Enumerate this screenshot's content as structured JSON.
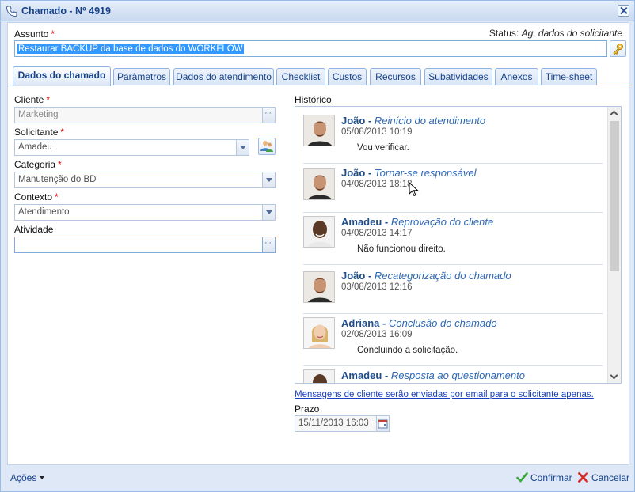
{
  "window": {
    "title": "Chamado - Nº 4919"
  },
  "header": {
    "subject_label": "Assunto",
    "status_prefix": "Status:",
    "status_value": "Ag. dados do solicitante",
    "subject_value": "Restaurar BACKUP da base de dados do WORKFLOW"
  },
  "tabs": [
    {
      "label": "Dados do chamado"
    },
    {
      "label": "Parâmetros"
    },
    {
      "label": "Dados do atendimento"
    },
    {
      "label": "Checklist"
    },
    {
      "label": "Custos"
    },
    {
      "label": "Recursos"
    },
    {
      "label": "Subatividades"
    },
    {
      "label": "Anexos"
    },
    {
      "label": "Time-sheet"
    }
  ],
  "form": {
    "cliente_label": "Cliente",
    "cliente_value": "Marketing",
    "solicitante_label": "Solicitante",
    "solicitante_value": "Amadeu",
    "categoria_label": "Categoria",
    "categoria_value": "Manutenção do BD",
    "contexto_label": "Contexto",
    "contexto_value": "Atendimento",
    "atividade_label": "Atividade",
    "atividade_value": ""
  },
  "history": {
    "label": "Histórico",
    "items": [
      {
        "name": "João",
        "action": "Reinício do atendimento",
        "date": "05/08/2013 10:19",
        "message": "Vou verificar."
      },
      {
        "name": "João",
        "action": "Tornar-se responsável",
        "date": "04/08/2013 18:18",
        "message": ""
      },
      {
        "name": "Amadeu",
        "action": "Reprovação do cliente",
        "date": "04/08/2013 14:17",
        "message": "Não funcionou direito."
      },
      {
        "name": "João",
        "action": "Recategorização do chamado",
        "date": "03/08/2013 12:16",
        "message": ""
      },
      {
        "name": "Adriana",
        "action": "Conclusão do chamado",
        "date": "02/08/2013 16:09",
        "message": "Concluindo a solicitação."
      },
      {
        "name": "Amadeu",
        "action": "Resposta ao questionamento",
        "date": "",
        "message": ""
      }
    ]
  },
  "notice_link": "Mensagens de cliente serão enviadas por email para o solicitante apenas.",
  "deadline": {
    "label": "Prazo",
    "value": "15/11/2013 16:03"
  },
  "footer": {
    "actions_label": "Ações",
    "confirm_label": "Confirmar",
    "cancel_label": "Cancelar"
  },
  "colors": {
    "accent": "#15428b",
    "link": "#1a3fbf",
    "required": "#dd0000"
  }
}
